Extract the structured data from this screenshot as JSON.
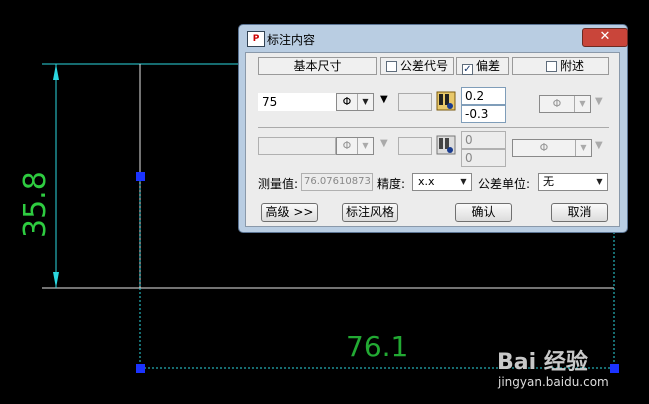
{
  "drawing": {
    "vertical_dimension": "35.8",
    "horizontal_dimension": "76.1",
    "watermark_brand": "Bai 经验",
    "watermark_url": "jingyan.baidu.com"
  },
  "dialog": {
    "title": "标注内容",
    "close_label": "✕",
    "headers": {
      "basic_size": "基本尺寸",
      "tolerance_code": "公差代号",
      "deviation": "偏差",
      "attached": "附述"
    },
    "row1": {
      "value": "75",
      "phi_symbol": "Φ",
      "upper_deviation": "0.2",
      "lower_deviation": "-0.3"
    },
    "row2": {
      "phi_symbol": "Φ",
      "upper_deviation": "0",
      "lower_deviation": "0"
    },
    "measured_label": "测量值:",
    "measured_value": "76.07610873",
    "precision_label": "精度:",
    "precision_value": "x.x",
    "tolerance_unit_label": "公差单位:",
    "tolerance_unit_value": "无",
    "buttons": {
      "advanced": "高级 >>",
      "style": "标注风格",
      "ok": "确认",
      "cancel": "取消"
    }
  }
}
